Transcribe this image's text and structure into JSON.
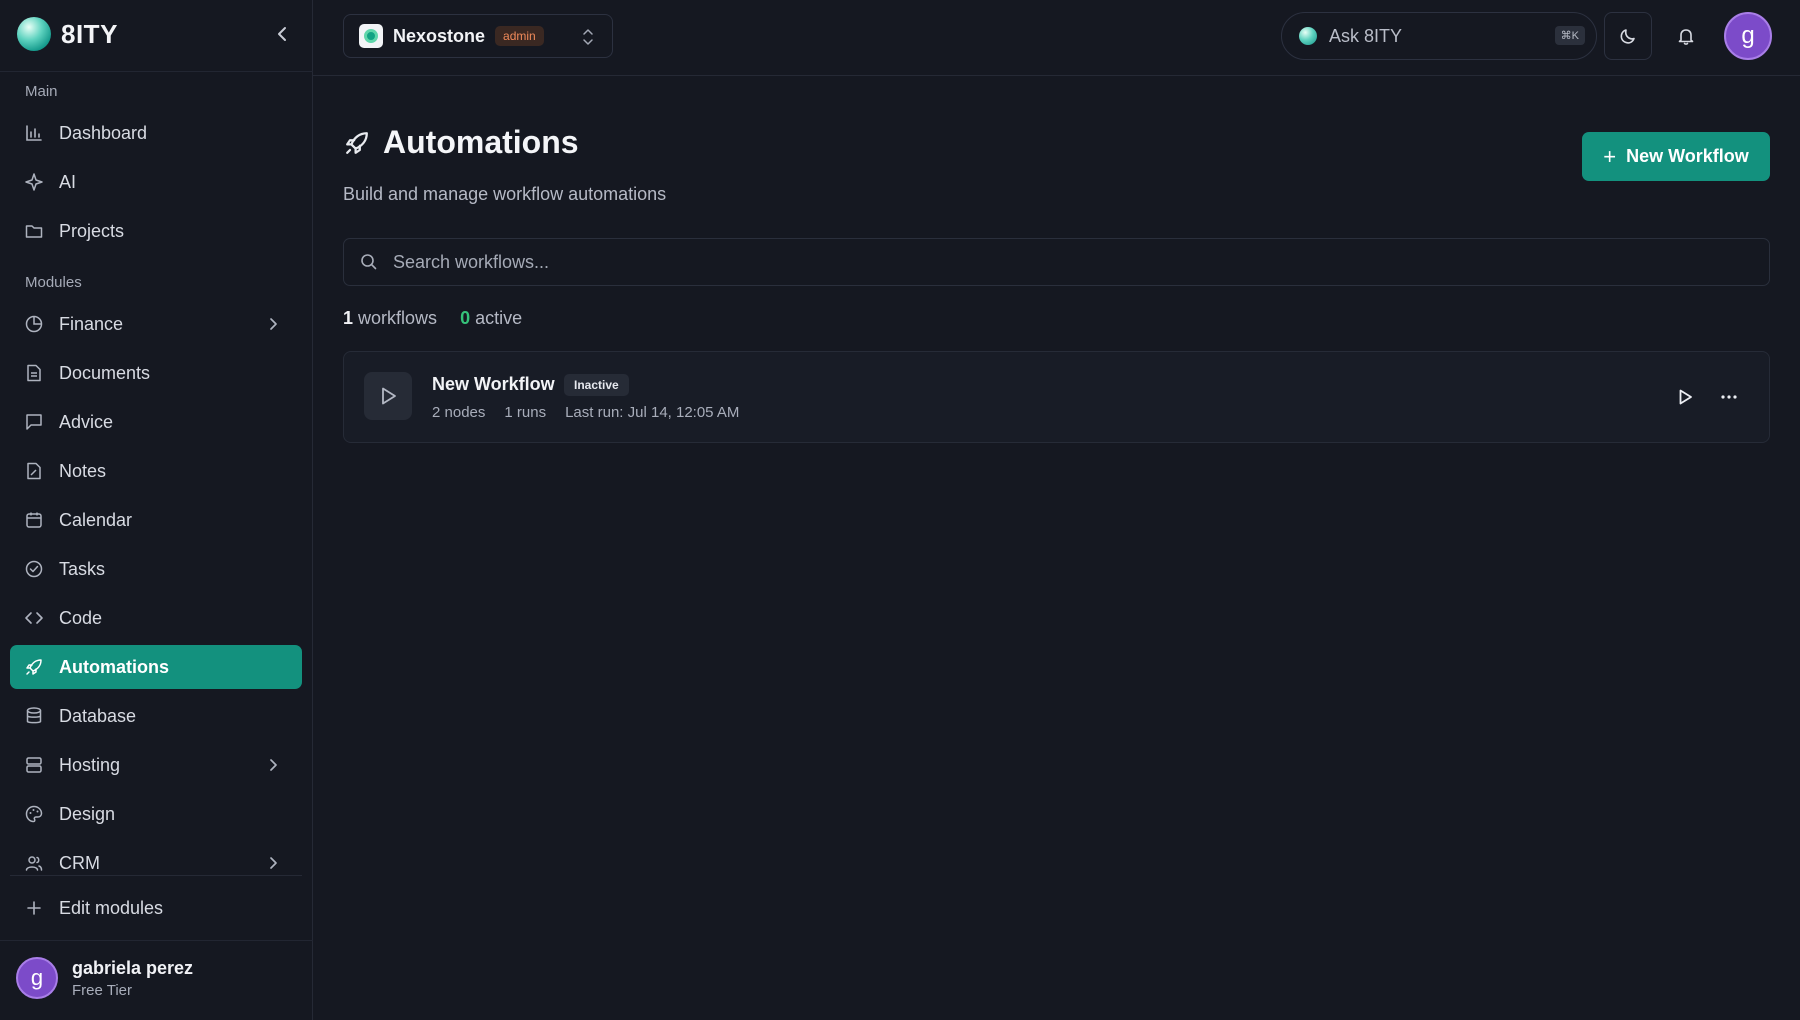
{
  "brand": {
    "name": "8ITY"
  },
  "sidebar": {
    "sections": {
      "main": "Main",
      "modules": "Modules"
    },
    "main_items": [
      {
        "label": "Dashboard",
        "icon": "bar-chart-icon"
      },
      {
        "label": "AI",
        "icon": "sparkle-icon"
      },
      {
        "label": "Projects",
        "icon": "folder-icon"
      }
    ],
    "module_items": [
      {
        "label": "Finance",
        "icon": "pie-chart-icon",
        "has_submenu": true
      },
      {
        "label": "Documents",
        "icon": "document-icon"
      },
      {
        "label": "Advice",
        "icon": "message-icon"
      },
      {
        "label": "Notes",
        "icon": "notes-icon"
      },
      {
        "label": "Calendar",
        "icon": "calendar-icon"
      },
      {
        "label": "Tasks",
        "icon": "check-circle-icon"
      },
      {
        "label": "Code",
        "icon": "code-icon"
      },
      {
        "label": "Automations",
        "icon": "rocket-icon",
        "active": true
      },
      {
        "label": "Database",
        "icon": "database-icon"
      },
      {
        "label": "Hosting",
        "icon": "server-icon",
        "has_submenu": true
      },
      {
        "label": "Design",
        "icon": "palette-icon"
      },
      {
        "label": "CRM",
        "icon": "users-icon",
        "has_submenu": true
      }
    ],
    "edit_modules": "Edit modules",
    "user": {
      "initial": "g",
      "name": "gabriela perez",
      "tier": "Free Tier"
    }
  },
  "topbar": {
    "org": {
      "name": "Nexostone",
      "role_badge": "admin"
    },
    "ask": {
      "label": "Ask 8ITY",
      "shortcut": "⌘K"
    },
    "avatar_initial": "g"
  },
  "main": {
    "title": "Automations",
    "subtitle": "Build and manage workflow automations",
    "new_button": "New Workflow",
    "search_placeholder": "Search workflows...",
    "stats": {
      "workflows_count": "1",
      "workflows_label": "workflows",
      "active_count": "0",
      "active_label": "active"
    },
    "workflows": [
      {
        "name": "New Workflow",
        "status": "Inactive",
        "nodes": "2 nodes",
        "runs": "1 runs",
        "last_run": "Last run: Jul 14, 12:05 AM"
      }
    ]
  },
  "colors": {
    "accent": "#13917e",
    "active_green": "#35c27a",
    "admin_badge": "#f08a5a",
    "avatar": "#7c4bc9"
  }
}
